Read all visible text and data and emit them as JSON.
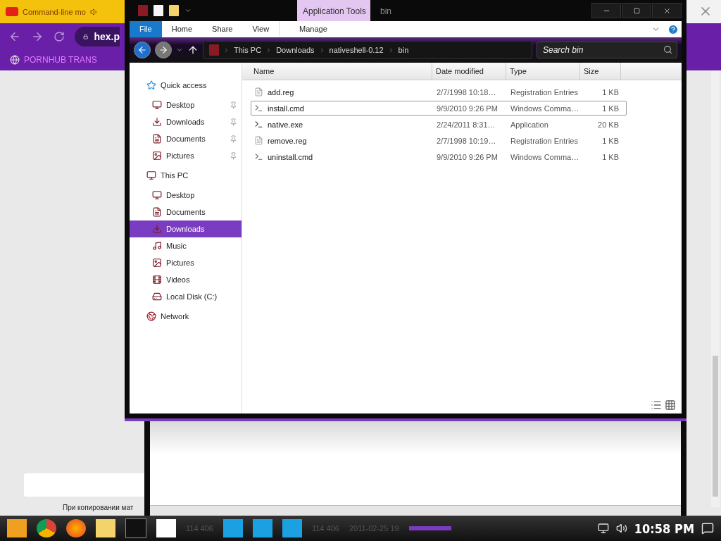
{
  "browser": {
    "tab_title": "Command-line mo",
    "url": "hex.p",
    "bookmark": "PORNHUB TRANS",
    "page_text": "При копировании мат"
  },
  "explorer": {
    "title": "bin",
    "context_label": "Application Tools",
    "ribbon_tabs": [
      {
        "label": "File",
        "kind": "file",
        "selected": false
      },
      {
        "label": "Home",
        "kind": "tab",
        "selected": false
      },
      {
        "label": "Share",
        "kind": "tab",
        "selected": false
      },
      {
        "label": "View",
        "kind": "tab",
        "selected": false
      },
      {
        "label": "Manage",
        "kind": "context",
        "selected": false
      }
    ],
    "breadcrumb": [
      "This PC",
      "Downloads",
      "nativeshell-0.12",
      "bin"
    ],
    "search": {
      "placeholder": "Search bin"
    },
    "nav": [
      {
        "label": "Quick access",
        "kind": "star",
        "selected": false,
        "children": [
          {
            "label": "Desktop",
            "kind": "desktop",
            "pinned": true,
            "selected": false
          },
          {
            "label": "Downloads",
            "kind": "downloads",
            "pinned": true,
            "selected": false
          },
          {
            "label": "Documents",
            "kind": "documents",
            "pinned": true,
            "selected": false
          },
          {
            "label": "Pictures",
            "kind": "pictures",
            "pinned": true,
            "selected": false
          }
        ]
      },
      {
        "label": "This PC",
        "kind": "pc",
        "selected": false,
        "children": [
          {
            "label": "Desktop",
            "kind": "desktop",
            "pinned": false,
            "selected": false
          },
          {
            "label": "Documents",
            "kind": "documents",
            "pinned": false,
            "selected": false
          },
          {
            "label": "Downloads",
            "kind": "downloads",
            "pinned": false,
            "selected": true
          },
          {
            "label": "Music",
            "kind": "music",
            "pinned": false,
            "selected": false
          },
          {
            "label": "Pictures",
            "kind": "pictures",
            "pinned": false,
            "selected": false
          },
          {
            "label": "Videos",
            "kind": "videos",
            "pinned": false,
            "selected": false
          },
          {
            "label": "Local Disk (C:)",
            "kind": "disk",
            "pinned": false,
            "selected": false
          }
        ]
      },
      {
        "label": "Network",
        "kind": "network",
        "selected": false
      }
    ],
    "columns": [
      "Name",
      "Date modified",
      "Type",
      "Size"
    ],
    "files": [
      {
        "name": "add.reg",
        "date": "2/7/1998 10:18…",
        "type": "Registration Entries",
        "size": "1 KB",
        "kind": "reg",
        "selected": false
      },
      {
        "name": "install.cmd",
        "date": "9/9/2010 9:26 PM",
        "type": "Windows Comma…",
        "size": "1 KB",
        "kind": "cmd",
        "selected": true
      },
      {
        "name": "native.exe",
        "date": "2/24/2011 8:31…",
        "type": "Application",
        "size": "20 KB",
        "kind": "exe",
        "selected": false
      },
      {
        "name": "remove.reg",
        "date": "2/7/1998 10:19…",
        "type": "Registration Entries",
        "size": "1 KB",
        "kind": "reg",
        "selected": false
      },
      {
        "name": "uninstall.cmd",
        "date": "9/9/2010 9:26 PM",
        "type": "Windows Comma…",
        "size": "1 KB",
        "kind": "cmd",
        "selected": false
      }
    ]
  },
  "taskbar": {
    "background_texts": [
      "114 406",
      "114 406",
      "2011-02-25 19"
    ],
    "clock": "10:58 PM"
  }
}
